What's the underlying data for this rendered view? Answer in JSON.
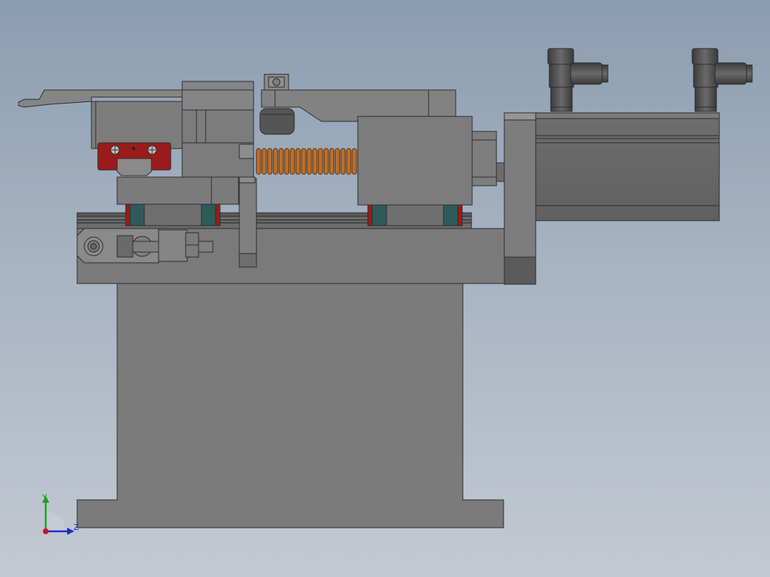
{
  "view": {
    "background_top": "#8b9db1",
    "background_bottom": "#c3c9d2"
  },
  "triad": {
    "y_label": "Y",
    "z_label": "Z",
    "y_color": "#1aa31a",
    "z_color": "#1a2fc8",
    "origin_color": "#c8102e"
  },
  "colors": {
    "body": "#7a7a7a",
    "body_light": "#8a8a8a",
    "body_dark": "#5e5e5e",
    "edge": "#2b2b2b",
    "rail_block_red": "#9b1b1b",
    "rail_block_teal": "#2e5a5a",
    "spring": "#b8702e",
    "spring_dark": "#6b3a12"
  },
  "icons": {
    "triad": "coordinate-triad-icon"
  }
}
